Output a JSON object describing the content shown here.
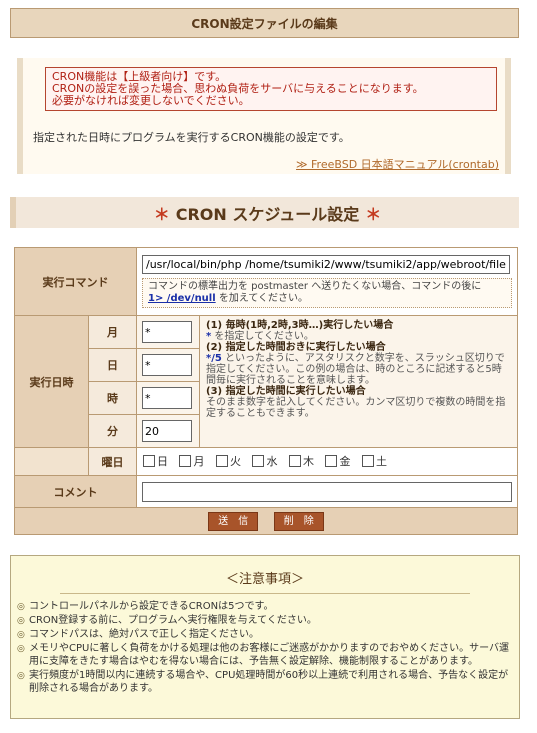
{
  "header": {
    "title": "CRON設定ファイルの編集"
  },
  "info": {
    "warning_lines": [
      "CRON機能は【上級者向け】です。",
      "CRONの設定を誤った場合、思わぬ負荷をサーバに与えることになります。",
      "必要がなければ変更しないでください。"
    ],
    "description": "指定された日時にプログラムを実行するCRON機能の設定です。",
    "manual_link": "≫ FreeBSD 日本語マニュアル(crontab)"
  },
  "schedule": {
    "title": "CRON スケジュール設定",
    "star": "＊"
  },
  "form": {
    "command_label": "実行コマンド",
    "command_value": "/usr/local/bin/php /home/tsumiki2/www/tsumiki2/app/webroot/file",
    "command_note_1": "コマンドの標準出力を postmaster へ送りたくない場合、コマンドの後に",
    "command_note_code": "1> /dev/null",
    "command_note_2": " を加えてください。",
    "datetime_label": "実行日時",
    "month_label": "月",
    "month_value": "*",
    "day_label": "日",
    "day_value": "*",
    "hour_label": "時",
    "hour_value": "*",
    "minute_label": "分",
    "minute_value": "20",
    "help_1_title": "(1) 毎時(1時,2時,3時…)実行したい場合",
    "help_1_symbol": "*",
    "help_1_text": " を指定してください。",
    "help_2_title": "(2) 指定した時間おきに実行したい場合",
    "help_2_symbol": "*/5",
    "help_2_text": " といったように、アスタリスクと数字を、スラッシュ区切りで指定してください。この例の場合は、時のところに記述すると5時間毎に実行されることを意味します。",
    "help_3_title": "(3) 指定した時間に実行したい場合",
    "help_3_text": "そのまま数字を記入してください。カンマ区切りで複数の時間を指定することもできます。",
    "weekday_label": "曜日",
    "weekdays": [
      "日",
      "月",
      "火",
      "水",
      "木",
      "金",
      "土"
    ],
    "comment_label": "コメント",
    "comment_value": "",
    "submit_label": "送　信",
    "delete_label": "削　除"
  },
  "notes": {
    "title": "＜注意事項＞",
    "items": [
      "コントロールパネルから設定できるCRONは5つです。",
      "CRON登録する前に、プログラムへ実行権限を与えてください。",
      "コマンドパスは、絶対パスで正しく指定ください。",
      "メモリやCPUに著しく負荷をかける処理は他のお客様にご迷惑がかかりますのでおやめください。サーバ運用に支障をきたす場合はやむを得ない場合には、予告無く設定解除、機能制限することがあります。",
      "実行頻度が1時間以内に連続する場合や、CPU処理時間が60秒以上連続で利用される場合、予告なく設定が削除される場合があります。"
    ]
  }
}
